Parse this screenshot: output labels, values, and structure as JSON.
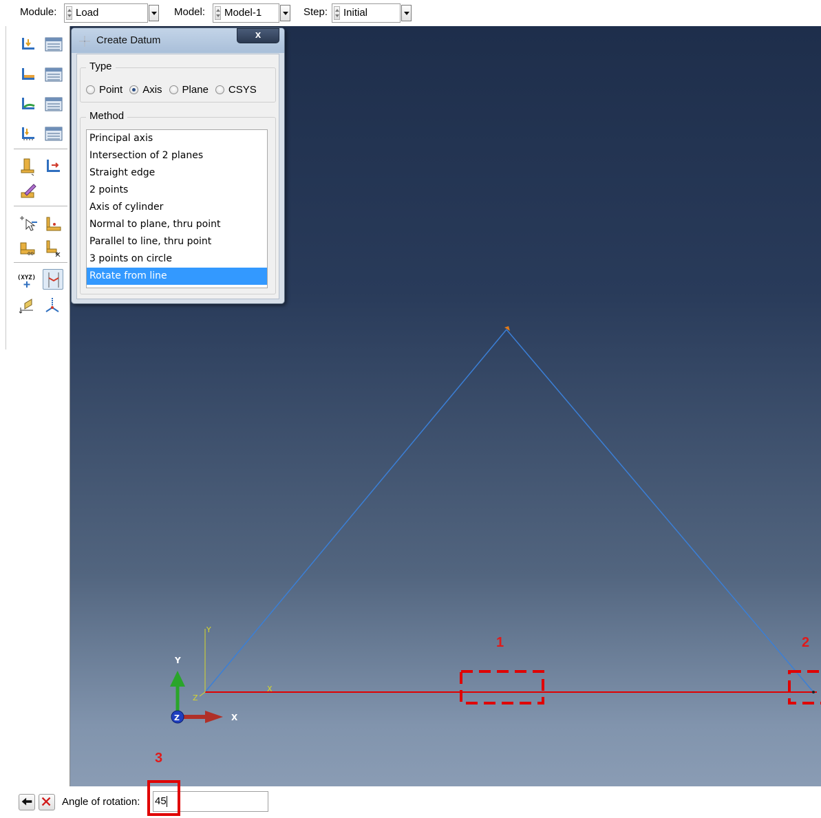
{
  "context_bar": {
    "module_label": "Module:",
    "module_value": "Load",
    "model_label": "Model:",
    "model_value": "Model-1",
    "step_label": "Step:",
    "step_value": "Initial"
  },
  "toolbox": {
    "tools": [
      "load-manager-icon",
      "load-table-icon",
      "bc-icon",
      "bc-table-icon",
      "predefined-field-icon",
      "field-table-icon",
      "load-case-icon",
      "load-case-table-icon",
      "create-load-icon",
      "create-bc-icon",
      "edit-field-icon",
      "select-icon",
      "create-connector-icon",
      "amplitude-icon",
      "remove-icon",
      "datum-point-icon",
      "datum-axis-icon",
      "datum-plane-icon",
      "datum-csys-icon"
    ]
  },
  "dialog": {
    "title": "Create Datum",
    "close_label": "x",
    "type_group": {
      "legend": "Type",
      "options": [
        "Point",
        "Axis",
        "Plane",
        "CSYS"
      ],
      "selected": "Axis"
    },
    "method_group": {
      "legend": "Method",
      "items": [
        "Principal axis",
        "Intersection of 2 planes",
        "Straight edge",
        "2 points",
        "Axis of cylinder",
        "Normal to plane, thru point",
        "Parallel to line, thru point",
        "3 points on circle",
        "Rotate from line"
      ],
      "selected": "Rotate from line"
    }
  },
  "viewport": {
    "sketch_axis_x": "X",
    "sketch_axis_y": "Y",
    "sketch_axis_z": "Z",
    "triad_x": "X",
    "triad_y": "Y",
    "triad_z": "Z",
    "annotations": [
      "1",
      "2",
      "3"
    ],
    "colors": {
      "truss": "#3b7fd6",
      "highlight_edge": "#e00000",
      "annotation": "#e01a1a",
      "triad_x": "#c0302a",
      "triad_y": "#2aa52a",
      "triad_z": "#1f3fbf",
      "sketch_axes": "#d7d72a"
    }
  },
  "prompt": {
    "label": "Angle of rotation:",
    "value": "45",
    "back_icon": "back-arrow-icon",
    "cancel_icon": "cancel-x-icon"
  }
}
